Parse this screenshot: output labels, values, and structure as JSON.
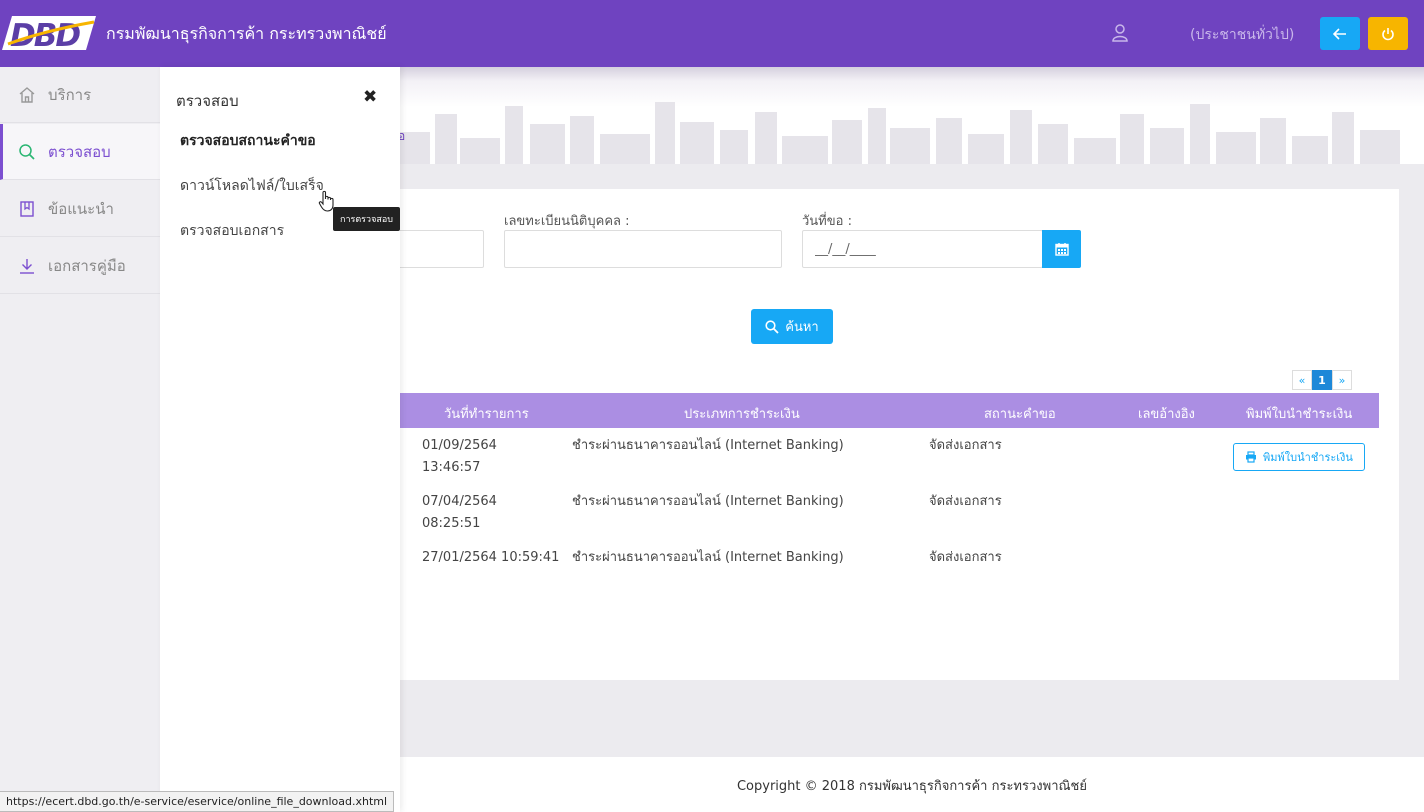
{
  "header": {
    "logo_text": "DBD",
    "title": "กรมพัฒนาธุรกิจการค้า กระทรวงพาณิชย์",
    "user_icon": "user-icon",
    "user_role": "(ประชาชนทั่วไป)",
    "back_icon": "arrow-left-icon",
    "power_icon": "power-icon",
    "colors": {
      "bar": "#6f43c0",
      "back": "#17a8f5",
      "power": "#f7b500"
    }
  },
  "breadcrumb": {
    "fragment": "อ"
  },
  "sidebar": {
    "items": [
      {
        "label": "บริการ",
        "icon": "home-icon",
        "active": false
      },
      {
        "label": "ตรวจสอบ",
        "icon": "search-icon",
        "active": true
      },
      {
        "label": "ข้อแนะนำ",
        "icon": "book-icon",
        "active": false
      },
      {
        "label": "เอกสารคู่มือ",
        "icon": "download-icon",
        "active": false
      }
    ]
  },
  "submenu": {
    "title": "ตรวจสอบ",
    "close": "✖",
    "items": [
      {
        "label": "ตรวจสอบสถานะคำขอ",
        "bold": true
      },
      {
        "label": "ดาวน์โหลดไฟล์/ใบเสร็จ",
        "bold": false
      },
      {
        "label": "ตรวจสอบเอกสาร",
        "bold": false
      }
    ],
    "tooltip": "การตรวจสอบ"
  },
  "form": {
    "reg_label": "เลขทะเบียนนิติบุคคล :",
    "reg_value": "",
    "date_label": "วันที่ขอ :",
    "date_value": "__/__/____",
    "calendar_icon": "calendar-icon",
    "search_label": "ค้นหา"
  },
  "pagination": {
    "prev": "«",
    "current": "1",
    "next": "»"
  },
  "table": {
    "columns": [
      "วันที่ทำรายการ",
      "ประเภทการชำระเงิน",
      "สถานะคำขอ",
      "เลขอ้างอิง",
      "พิมพ์ใบนำชำระเงิน"
    ],
    "rows": [
      {
        "date": "01/09/2564",
        "time": "13:46:57",
        "payment": "ชำระผ่านธนาคารออนไลน์ (Internet Banking)",
        "status": "จัดส่งเอกสาร",
        "ref": "",
        "print": "พิมพ์ใบนำชำระเงิน"
      },
      {
        "date": "07/04/2564",
        "time": "08:25:51",
        "payment": "ชำระผ่านธนาคารออนไลน์ (Internet Banking)",
        "status": "จัดส่งเอกสาร",
        "ref": "",
        "print": ""
      },
      {
        "date": "27/01/2564 10:59:41",
        "time": "",
        "payment": "ชำระผ่านธนาคารออนไลน์ (Internet Banking)",
        "status": "จัดส่งเอกสาร",
        "ref": "",
        "print": ""
      }
    ]
  },
  "footer": {
    "copyright": "Copyright © 2018 กรมพัฒนาธุรกิจการค้า กระทรวงพาณิชย์"
  },
  "statusbar": {
    "url": "https://ecert.dbd.go.th/e-service/eservice/online_file_download.xhtml"
  }
}
